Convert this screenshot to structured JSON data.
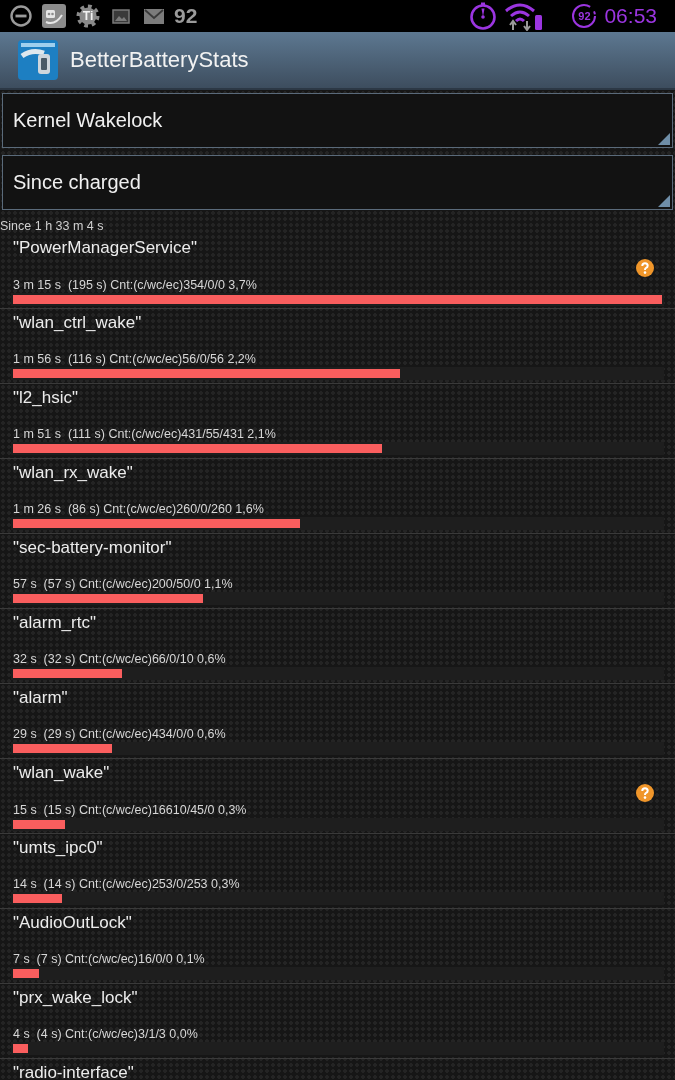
{
  "status_bar": {
    "app_badge": "Ti",
    "notification_count": "92",
    "battery_percent": "92",
    "time": "06:53"
  },
  "action_bar": {
    "title": "BetterBatteryStats"
  },
  "spinners": [
    {
      "value": "Kernel Wakelock"
    },
    {
      "value": "Since charged"
    }
  ],
  "since": "Since 1 h 33 m 4 s",
  "wakelocks": [
    {
      "name": "\"PowerManagerService\"",
      "stats": "3 m 15 s  (195 s) Cnt:(c/wc/ec)354/0/0 3,7%",
      "level": 1.0,
      "has_info": true
    },
    {
      "name": "\"wlan_ctrl_wake\"",
      "stats": "1 m 56 s  (116 s) Cnt:(c/wc/ec)56/0/56 2,2%",
      "level": 0.596,
      "has_info": false
    },
    {
      "name": "\"l2_hsic\"",
      "stats": "1 m 51 s  (111 s) Cnt:(c/wc/ec)431/55/431 2,1%",
      "level": 0.569,
      "has_info": false
    },
    {
      "name": "\"wlan_rx_wake\"",
      "stats": "1 m 26 s  (86 s) Cnt:(c/wc/ec)260/0/260 1,6%",
      "level": 0.442,
      "has_info": false
    },
    {
      "name": "\"sec-battery-monitor\"",
      "stats": "57 s  (57 s) Cnt:(c/wc/ec)200/50/0 1,1%",
      "level": 0.293,
      "has_info": false
    },
    {
      "name": "\"alarm_rtc\"",
      "stats": "32 s  (32 s) Cnt:(c/wc/ec)66/0/10 0,6%",
      "level": 0.168,
      "has_info": false
    },
    {
      "name": "\"alarm\"",
      "stats": "29 s  (29 s) Cnt:(c/wc/ec)434/0/0 0,6%",
      "level": 0.153,
      "has_info": false
    },
    {
      "name": "\"wlan_wake\"",
      "stats": "15 s  (15 s) Cnt:(c/wc/ec)16610/45/0 0,3%",
      "level": 0.08,
      "has_info": true
    },
    {
      "name": "\"umts_ipc0\"",
      "stats": "14 s  (14 s) Cnt:(c/wc/ec)253/0/253 0,3%",
      "level": 0.075,
      "has_info": false
    },
    {
      "name": "\"AudioOutLock\"",
      "stats": "7 s  (7 s) Cnt:(c/wc/ec)16/0/0 0,1%",
      "level": 0.04,
      "has_info": false
    },
    {
      "name": "\"prx_wake_lock\"",
      "stats": "4 s  (4 s) Cnt:(c/wc/ec)3/1/3 0,0%",
      "level": 0.023,
      "has_info": false
    },
    {
      "name": "\"radio-interface\"",
      "has_info": false
    }
  ]
}
